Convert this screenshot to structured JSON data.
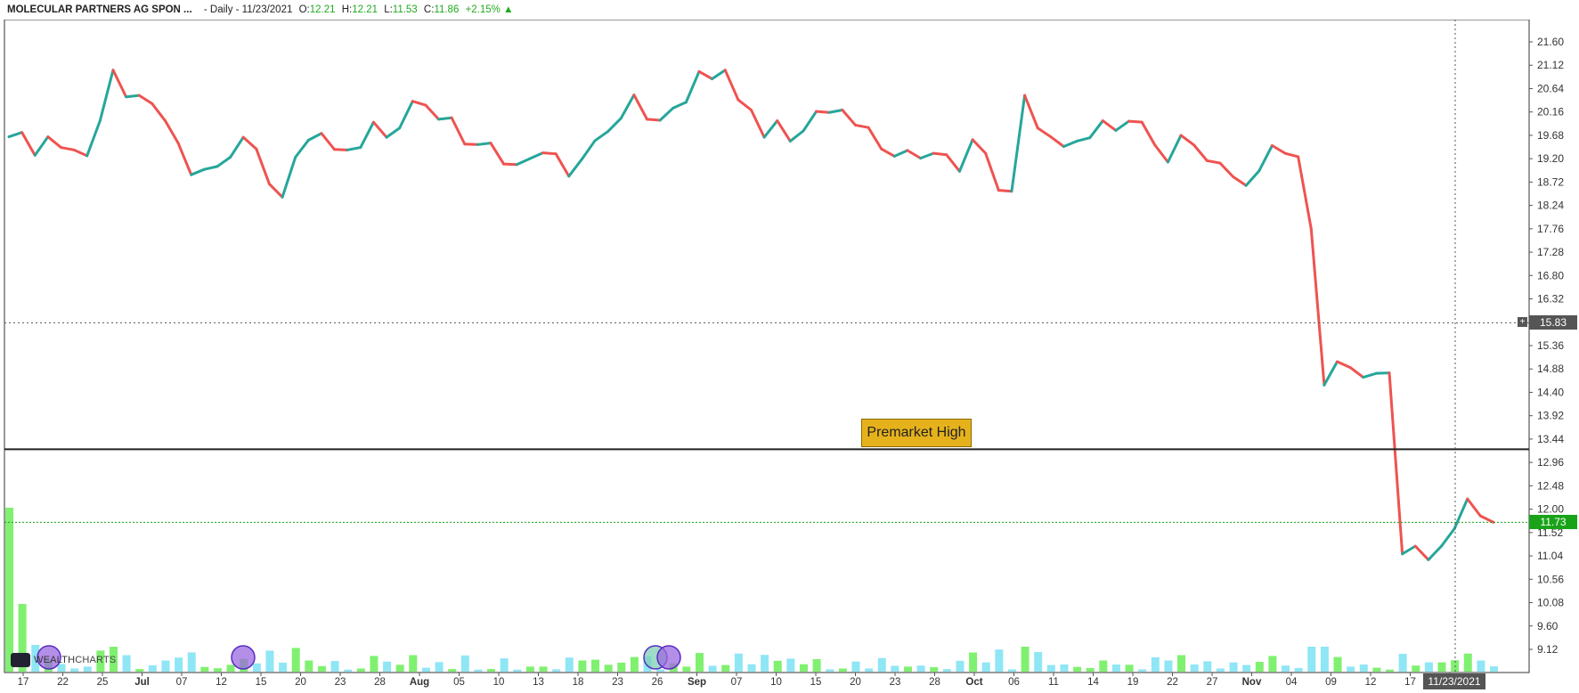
{
  "header": {
    "symbol": "MOLECULAR PARTNERS AG SPON ...",
    "info": "- Daily - 11/23/2021",
    "open_label": "O:",
    "open": "12.21",
    "high_label": "H:",
    "high": "12.21",
    "low_label": "L:",
    "low": "11.53",
    "close_label": "C:",
    "close": "11.86",
    "change": "+2.15%",
    "change_icon": "up-triangle-icon"
  },
  "toolbar": {
    "buttons": [
      "pencil-icon",
      "chevron-down-icon",
      "chevron-up-icon"
    ],
    "add_icon": "plus-icon"
  },
  "annotation": {
    "label": "Premarket High",
    "price": 13.23
  },
  "crosshair": {
    "price_label": "15.83",
    "date_label": "11/23/2021"
  },
  "last_price": {
    "label": "11.73"
  },
  "brand": {
    "prefix": "WEALTH",
    "suffix": "CHARTS"
  },
  "colors": {
    "up": "#26a69a",
    "down": "#ef5350",
    "volume_up": "#80f070",
    "volume_down": "#8fe6f5",
    "annotation": "#e6b21c"
  },
  "chart_data": {
    "type": "line",
    "y_axis_ticks": [
      "21.60",
      "21.12",
      "20.64",
      "20.16",
      "19.68",
      "19.20",
      "18.72",
      "18.24",
      "17.76",
      "17.28",
      "16.80",
      "16.32",
      "15.84",
      "15.36",
      "14.88",
      "14.40",
      "13.92",
      "13.44",
      "12.96",
      "12.48",
      "12.00",
      "11.52",
      "11.04",
      "10.56",
      "10.08",
      "9.60",
      "9.12"
    ],
    "ylim": [
      8.87,
      21.84
    ],
    "x_axis_labels": [
      "17",
      "22",
      "25",
      "Jul",
      "07",
      "12",
      "15",
      "20",
      "23",
      "28",
      "Aug",
      "05",
      "10",
      "13",
      "18",
      "23",
      "26",
      "Sep",
      "07",
      "10",
      "15",
      "20",
      "23",
      "28",
      "Oct",
      "06",
      "11",
      "14",
      "19",
      "22",
      "27",
      "Nov",
      "04",
      "09",
      "12",
      "17",
      "22"
    ],
    "close_values": [
      19.65,
      19.74,
      19.27,
      19.65,
      19.43,
      19.38,
      19.26,
      19.98,
      21.02,
      20.47,
      20.5,
      20.33,
      19.98,
      19.52,
      18.87,
      18.98,
      19.04,
      19.23,
      19.64,
      19.4,
      18.68,
      18.41,
      19.23,
      19.58,
      19.72,
      19.39,
      19.38,
      19.43,
      19.95,
      19.64,
      19.83,
      20.38,
      20.3,
      20.01,
      20.04,
      19.5,
      19.49,
      19.52,
      19.09,
      19.08,
      19.2,
      19.32,
      19.3,
      18.84,
      19.19,
      19.57,
      19.76,
      20.03,
      20.51,
      20.01,
      19.99,
      20.24,
      20.36,
      20.99,
      20.84,
      21.02,
      20.41,
      20.2,
      19.64,
      19.98,
      19.56,
      19.77,
      20.17,
      20.15,
      20.2,
      19.89,
      19.84,
      19.4,
      19.25,
      19.37,
      19.21,
      19.31,
      19.28,
      18.94,
      19.59,
      19.31,
      18.55,
      18.53,
      20.5,
      19.83,
      19.65,
      19.45,
      19.56,
      19.63,
      19.98,
      19.78,
      19.97,
      19.95,
      19.48,
      19.13,
      19.68,
      19.48,
      19.16,
      19.11,
      18.83,
      18.65,
      18.95,
      19.47,
      19.31,
      19.24,
      17.76,
      14.55,
      15.03,
      14.91,
      14.71,
      14.79,
      14.8,
      11.08,
      11.24,
      10.96,
      11.24,
      11.6,
      12.21,
      11.86,
      11.73
    ]
  }
}
